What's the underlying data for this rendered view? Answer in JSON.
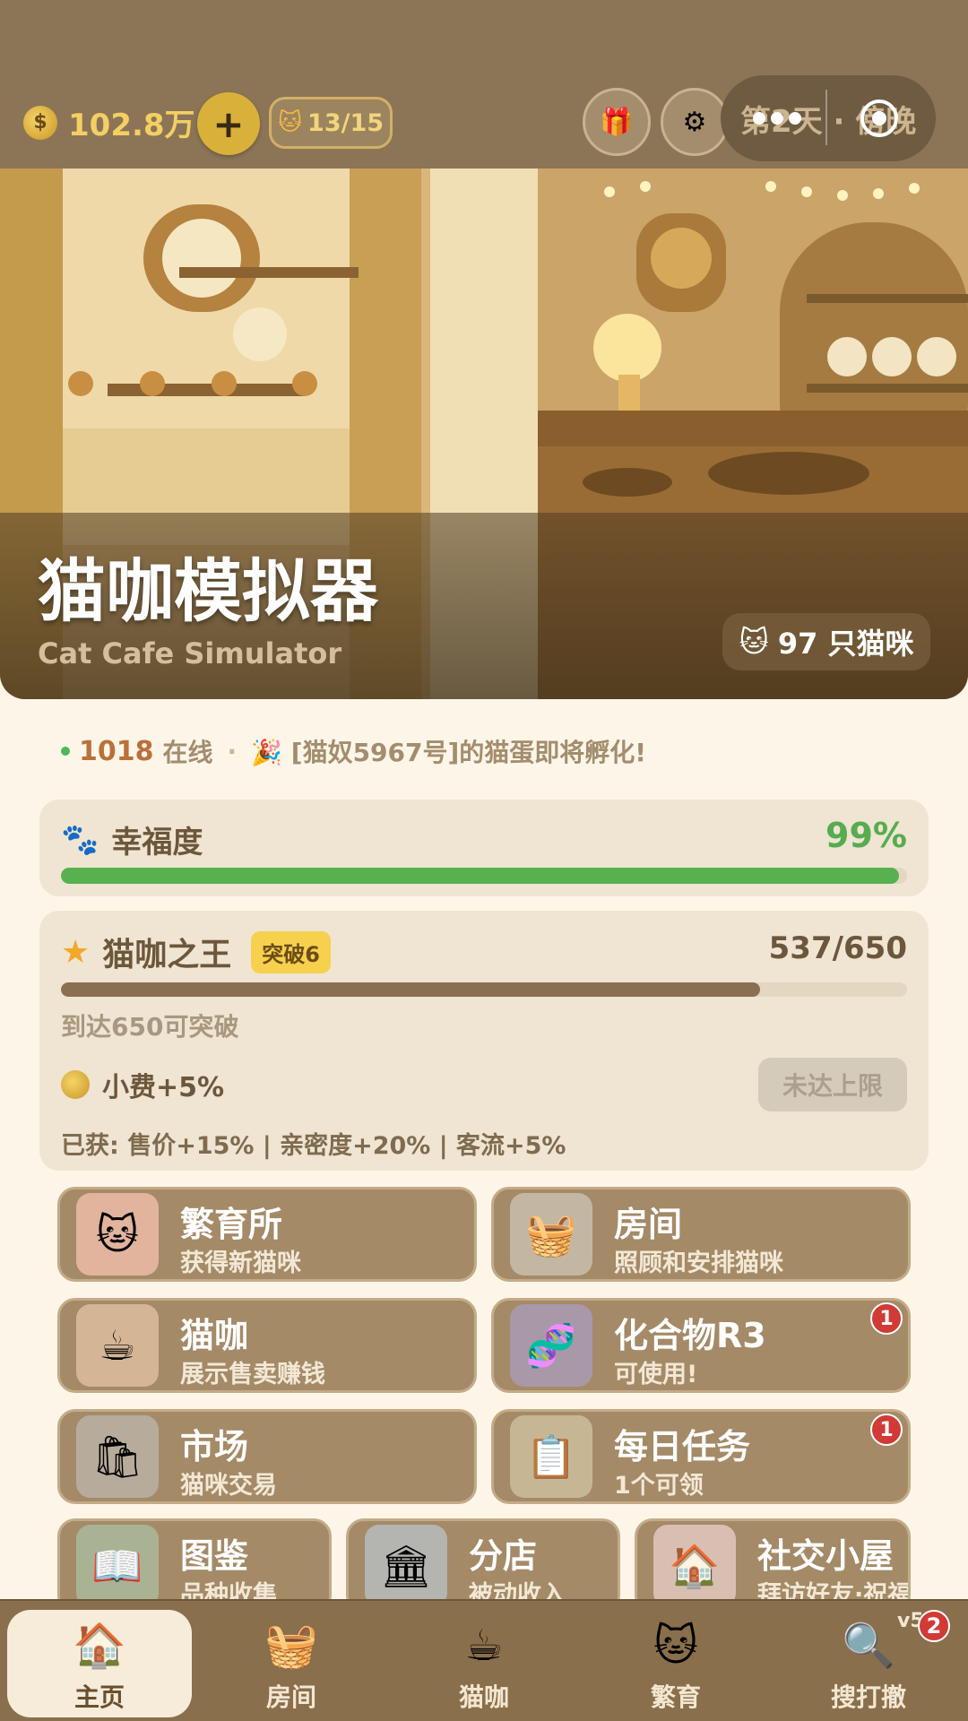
{
  "header": {
    "coin_amount": "102.8万",
    "plus_label": "+",
    "cat_capacity": "13/15",
    "day_label": "第2天 · 傍晚"
  },
  "hero": {
    "title": "猫咖模拟器",
    "subtitle": "Cat Cafe Simulator",
    "cat_count": "97 只猫咪"
  },
  "ticker": {
    "online_count": "1018",
    "online_label": "在线",
    "message": "🎉 [猫奴5967号]的猫蛋即将孵化!"
  },
  "happiness": {
    "label": "幸福度",
    "value": "99%",
    "fraction": 0.99
  },
  "king": {
    "title": "猫咖之王",
    "badge": "突破6",
    "progress_text": "537/650",
    "current": 537,
    "max": 650,
    "hint": "到达650可突破",
    "tip": "小费+5%",
    "limit_button": "未达上限",
    "gained": "已获: 售价+15% | 亲密度+20% | 客流+5%"
  },
  "tiles": [
    {
      "title": "繁育所",
      "subtitle": "获得新猫咪",
      "icon": "kittens-icon"
    },
    {
      "title": "房间",
      "subtitle": "照顾和安排猫咪",
      "icon": "cat-bed-icon"
    },
    {
      "title": "猫咖",
      "subtitle": "展示售卖赚钱",
      "icon": "cat-cup-icon"
    },
    {
      "title": "化合物R3",
      "subtitle": "可使用!",
      "icon": "dna-icon",
      "badge": "1"
    },
    {
      "title": "市场",
      "subtitle": "猫咪交易",
      "icon": "shopping-bag-icon"
    },
    {
      "title": "每日任务",
      "subtitle": "1个可领",
      "icon": "clipboard-icon",
      "badge": "1"
    },
    {
      "title": "图鉴",
      "subtitle": "品种收集",
      "icon": "book-icon"
    },
    {
      "title": "分店",
      "subtitle": "被动收入",
      "icon": "building-icon"
    },
    {
      "title": "社交小屋",
      "subtitle": "拜访好友·祝福赠猫",
      "icon": "social-house-icon"
    }
  ],
  "nav": {
    "items": [
      {
        "label": "主页",
        "icon": "house-icon"
      },
      {
        "label": "房间",
        "icon": "cat-bed-icon"
      },
      {
        "label": "猫咖",
        "icon": "cat-cup-icon"
      },
      {
        "label": "繁育",
        "icon": "kittens-icon"
      },
      {
        "label": "搜打撤",
        "icon": "magnifier-icon"
      }
    ],
    "version": "v52",
    "badge": "2"
  }
}
